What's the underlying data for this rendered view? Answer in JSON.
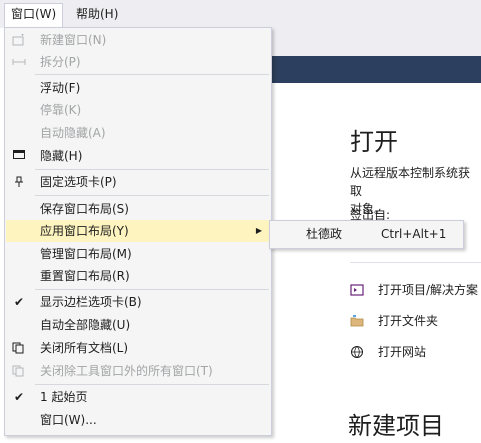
{
  "menubar": {
    "window_label": "窗口(W)",
    "help_label": "帮助(H)"
  },
  "start_page": {
    "title": "打开",
    "description": "从远程版本控制系统获取\n对象。",
    "checkout_label": "签出自:",
    "links": [
      {
        "label": "打开项目/解决方案",
        "icon": "vs-project-icon"
      },
      {
        "label": "打开文件夹",
        "icon": "folder-icon"
      },
      {
        "label": "打开网站",
        "icon": "globe-icon"
      }
    ],
    "new_project_title": "新建项目"
  },
  "window_menu": {
    "items": [
      {
        "label": "新建窗口(N)",
        "icon": "new-window-icon",
        "disabled": true
      },
      {
        "label": "拆分(P)",
        "icon": "split-icon",
        "disabled": true
      },
      {
        "label": "浮动(F)",
        "icon": "",
        "disabled": false
      },
      {
        "label": "停靠(K)",
        "icon": "",
        "disabled": true
      },
      {
        "label": "自动隐藏(A)",
        "icon": "",
        "disabled": true
      },
      {
        "label": "隐藏(H)",
        "icon": "hide-window-icon",
        "disabled": false
      },
      {
        "label": "固定选项卡(P)",
        "icon": "pin-icon",
        "disabled": false
      },
      {
        "label": "保存窗口布局(S)",
        "icon": "",
        "disabled": false
      },
      {
        "label": "应用窗口布局(Y)",
        "icon": "",
        "disabled": false,
        "highlighted": true,
        "submenu": true
      },
      {
        "label": "管理窗口布局(M)",
        "icon": "",
        "disabled": false
      },
      {
        "label": "重置窗口布局(R)",
        "icon": "",
        "disabled": false
      },
      {
        "label": "显示边栏选项卡(B)",
        "icon": "checkmark-icon",
        "disabled": false
      },
      {
        "label": "自动全部隐藏(U)",
        "icon": "",
        "disabled": false
      },
      {
        "label": "关闭所有文档(L)",
        "icon": "close-all-docs-icon",
        "disabled": false
      },
      {
        "label": "关闭除工具窗口外的所有窗口(T)",
        "icon": "close-all-but-tool-icon",
        "disabled": true
      },
      {
        "label": "1 起始页",
        "icon": "checkmark-icon",
        "disabled": false
      },
      {
        "label": "窗口(W)...",
        "icon": "",
        "disabled": false
      }
    ]
  },
  "layout_submenu": {
    "name": "杜德政",
    "shortcut": "Ctrl+Alt+1"
  },
  "colors": {
    "menu_bg": "#f5f5f5",
    "highlight": "#fdf4bf",
    "disabled_text": "#a2a4a5",
    "header_band": "#2d3f5e"
  }
}
